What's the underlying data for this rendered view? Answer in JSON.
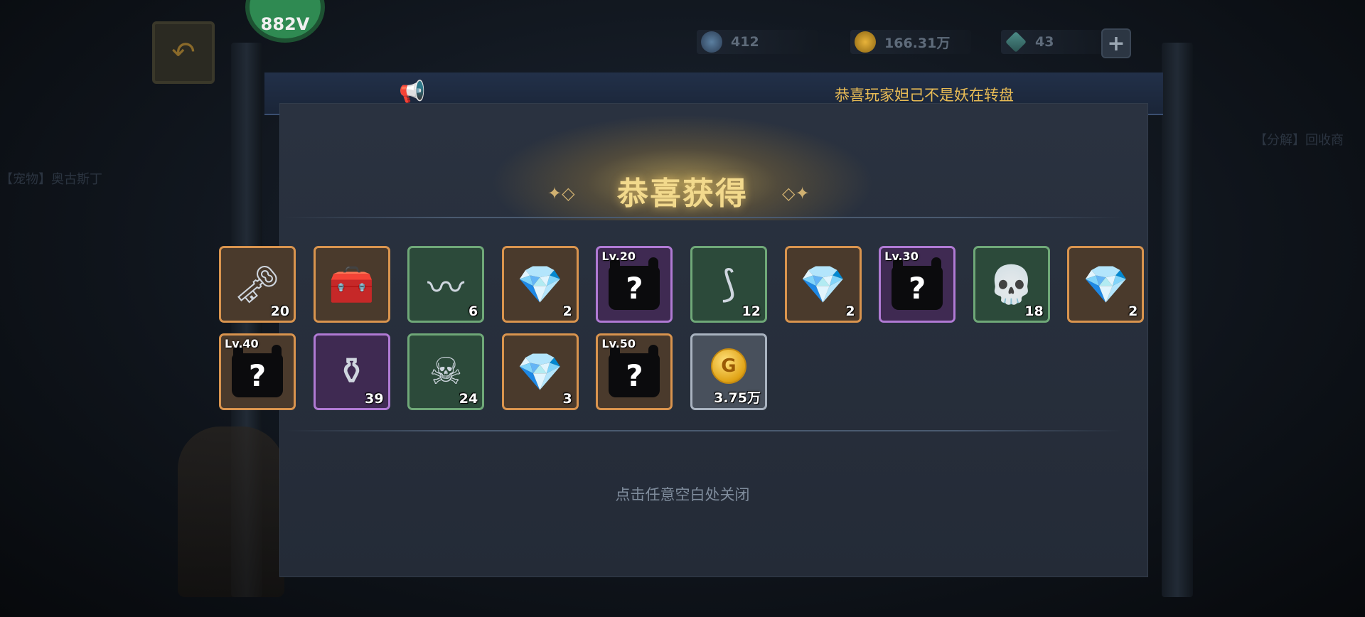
{
  "hud": {
    "avatar_level": "882V",
    "currencies": [
      {
        "icon": "gem-orb-icon",
        "value": "412"
      },
      {
        "icon": "gold-coin-icon",
        "value": "166.31万"
      },
      {
        "icon": "diamond-icon",
        "value": "43"
      }
    ],
    "plus_label": "+"
  },
  "background": {
    "left_label": "【宠物】奥古斯丁",
    "right_label": "【分解】回收商"
  },
  "announcement": {
    "icon": "megaphone-icon",
    "text": "恭喜玩家妲己不是妖在转盘"
  },
  "dialog": {
    "title": "恭喜获得",
    "close_hint": "点击任意空白处关闭"
  },
  "items": [
    {
      "rarity": "orange",
      "icon": "golden-key-icon",
      "glyph": "🗝",
      "level": "",
      "count": "20"
    },
    {
      "rarity": "orange",
      "icon": "treasure-chest-icon",
      "glyph": "🧰",
      "level": "",
      "count": ""
    },
    {
      "rarity": "green",
      "icon": "claw-icon",
      "glyph": "〰",
      "level": "",
      "count": "6"
    },
    {
      "rarity": "orange",
      "icon": "crystal-chest-icon",
      "glyph": "💎",
      "level": "",
      "count": "2"
    },
    {
      "rarity": "purple",
      "icon": "mystery-armor-icon",
      "glyph": "?",
      "level": "Lv.20",
      "count": ""
    },
    {
      "rarity": "green",
      "icon": "horn-icon",
      "glyph": "⟆",
      "level": "",
      "count": "12"
    },
    {
      "rarity": "orange",
      "icon": "crystal-chest-icon",
      "glyph": "💎",
      "level": "",
      "count": "2"
    },
    {
      "rarity": "purple",
      "icon": "mystery-armor-icon",
      "glyph": "?",
      "level": "Lv.30",
      "count": ""
    },
    {
      "rarity": "green",
      "icon": "beast-skull-icon",
      "glyph": "💀",
      "level": "",
      "count": "18"
    },
    {
      "rarity": "orange",
      "icon": "crystal-chest-icon",
      "glyph": "💎",
      "level": "",
      "count": "2"
    },
    {
      "rarity": "orange",
      "icon": "mystery-armor-icon",
      "glyph": "?",
      "level": "Lv.40",
      "count": ""
    },
    {
      "rarity": "purple",
      "icon": "potion-sack-icon",
      "glyph": "⚱",
      "level": "",
      "count": "39"
    },
    {
      "rarity": "green",
      "icon": "skeleton-icon",
      "glyph": "☠",
      "level": "",
      "count": "24"
    },
    {
      "rarity": "orange",
      "icon": "crystal-chest-icon",
      "glyph": "💎",
      "level": "",
      "count": "3"
    },
    {
      "rarity": "orange",
      "icon": "mystery-armor-icon",
      "glyph": "?",
      "level": "Lv.50",
      "count": ""
    },
    {
      "rarity": "grey",
      "icon": "gold-coin-icon",
      "glyph": "G",
      "level": "",
      "count": "3.75万"
    }
  ],
  "colors": {
    "rarity_orange": "#d9944e",
    "rarity_green": "#6fa878",
    "rarity_purple": "#b07ad4",
    "rarity_grey": "#a9b3c0",
    "title_gold": "#f2d98c",
    "announce_text": "#e8bb55"
  }
}
